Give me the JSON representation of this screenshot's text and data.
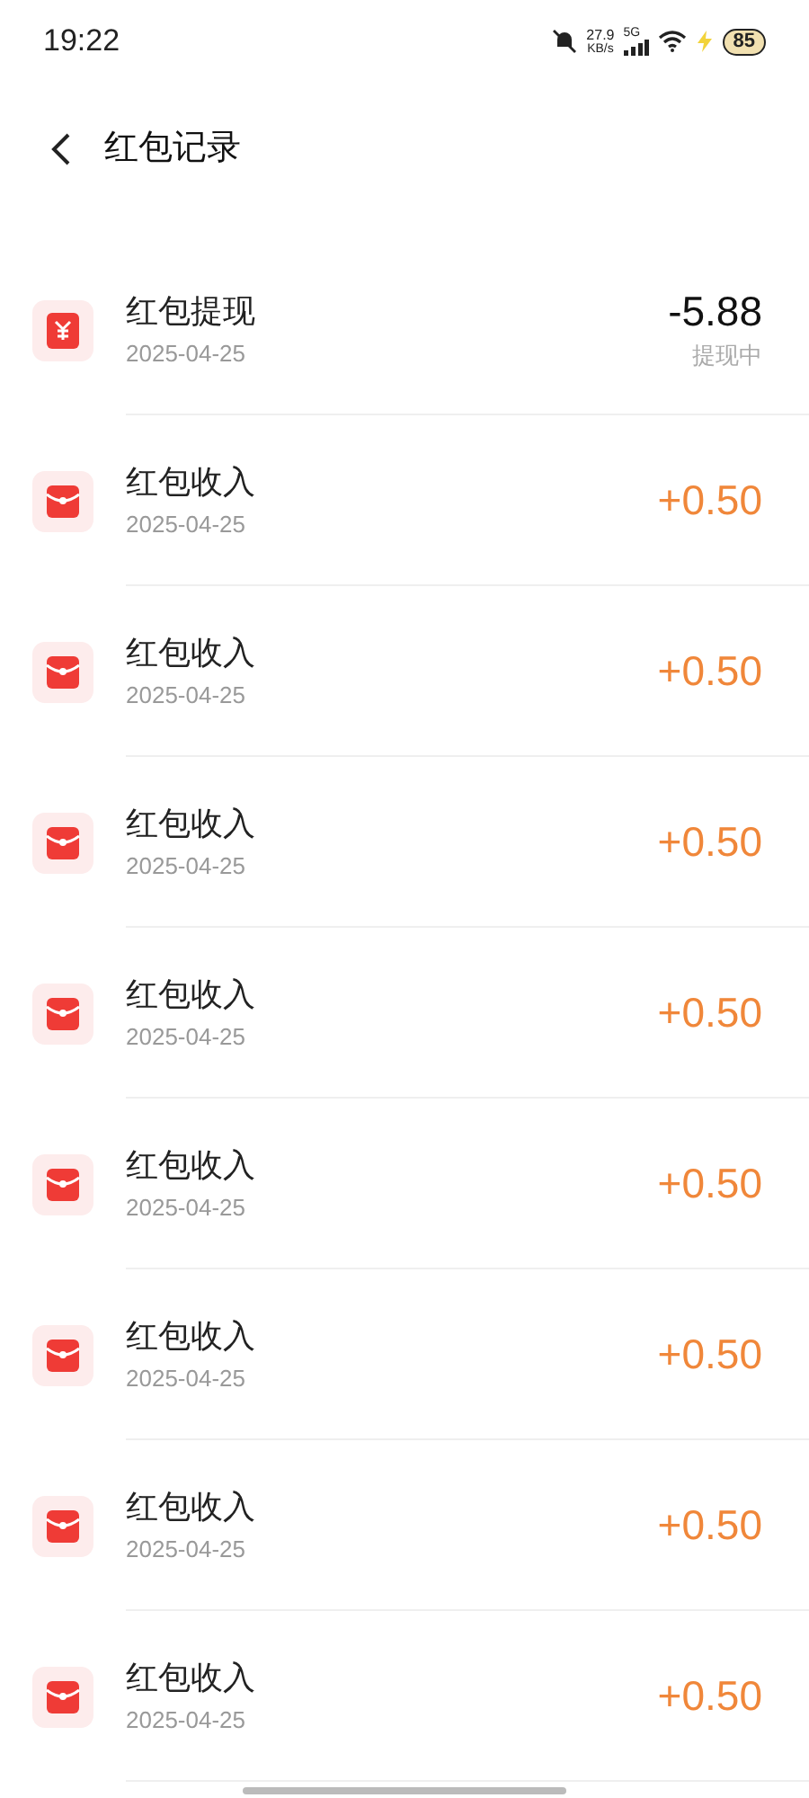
{
  "status_bar": {
    "time": "19:22",
    "speed": "27.9",
    "speed_unit": "KB/s",
    "network": "5G",
    "battery": "85"
  },
  "header": {
    "title": "红包记录"
  },
  "records": [
    {
      "kind": "withdrawal",
      "title": "红包提现",
      "date": "2025-04-25",
      "amount": "-5.88",
      "status": "提现中"
    },
    {
      "kind": "income",
      "title": "红包收入",
      "date": "2025-04-25",
      "amount": "+0.50"
    },
    {
      "kind": "income",
      "title": "红包收入",
      "date": "2025-04-25",
      "amount": "+0.50"
    },
    {
      "kind": "income",
      "title": "红包收入",
      "date": "2025-04-25",
      "amount": "+0.50"
    },
    {
      "kind": "income",
      "title": "红包收入",
      "date": "2025-04-25",
      "amount": "+0.50"
    },
    {
      "kind": "income",
      "title": "红包收入",
      "date": "2025-04-25",
      "amount": "+0.50"
    },
    {
      "kind": "income",
      "title": "红包收入",
      "date": "2025-04-25",
      "amount": "+0.50"
    },
    {
      "kind": "income",
      "title": "红包收入",
      "date": "2025-04-25",
      "amount": "+0.50"
    },
    {
      "kind": "income",
      "title": "红包收入",
      "date": "2025-04-25",
      "amount": "+0.50"
    }
  ]
}
